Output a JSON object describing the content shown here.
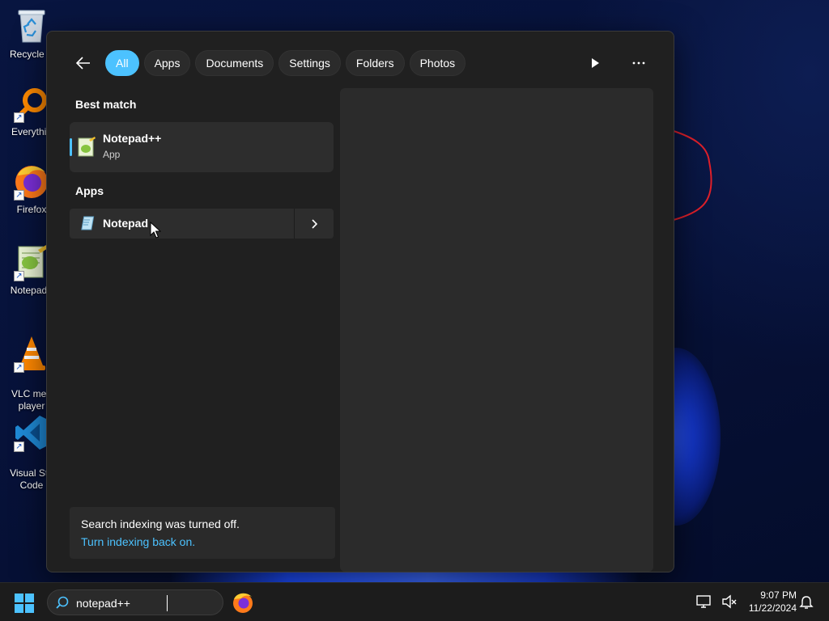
{
  "desktop": {
    "icons": [
      {
        "label": "Recycle B",
        "icon": "recycle-bin-icon"
      },
      {
        "label": "Everythin",
        "icon": "everything-search-icon"
      },
      {
        "label": "Firefox",
        "icon": "firefox-icon"
      },
      {
        "label": "Notepad+",
        "icon": "notepad-plus-plus-icon"
      },
      {
        "label": "VLC med\nplayer",
        "icon": "vlc-icon"
      },
      {
        "label": "Visual Stu\nCode",
        "icon": "vscode-icon"
      }
    ],
    "shortcut_glyph": "↗"
  },
  "search_panel": {
    "filters": [
      {
        "label": "All",
        "active": true
      },
      {
        "label": "Apps",
        "active": false
      },
      {
        "label": "Documents",
        "active": false
      },
      {
        "label": "Settings",
        "active": false
      },
      {
        "label": "Folders",
        "active": false
      },
      {
        "label": "Photos",
        "active": false
      }
    ],
    "best_match": {
      "heading": "Best match",
      "name": "Notepad++",
      "type": "App"
    },
    "apps": {
      "heading": "Apps",
      "items": [
        {
          "name": "Notepad"
        }
      ]
    },
    "indexing": {
      "message": "Search indexing was turned off.",
      "link": "Turn indexing back on."
    }
  },
  "taskbar": {
    "search_value": "notepad++",
    "time": "9:07 PM",
    "date": "11/22/2024"
  },
  "colors": {
    "accent": "#4cc2ff",
    "panel_bg": "#202020",
    "card_bg": "#2d2d2d",
    "taskbar_bg": "#1c1c1c"
  }
}
